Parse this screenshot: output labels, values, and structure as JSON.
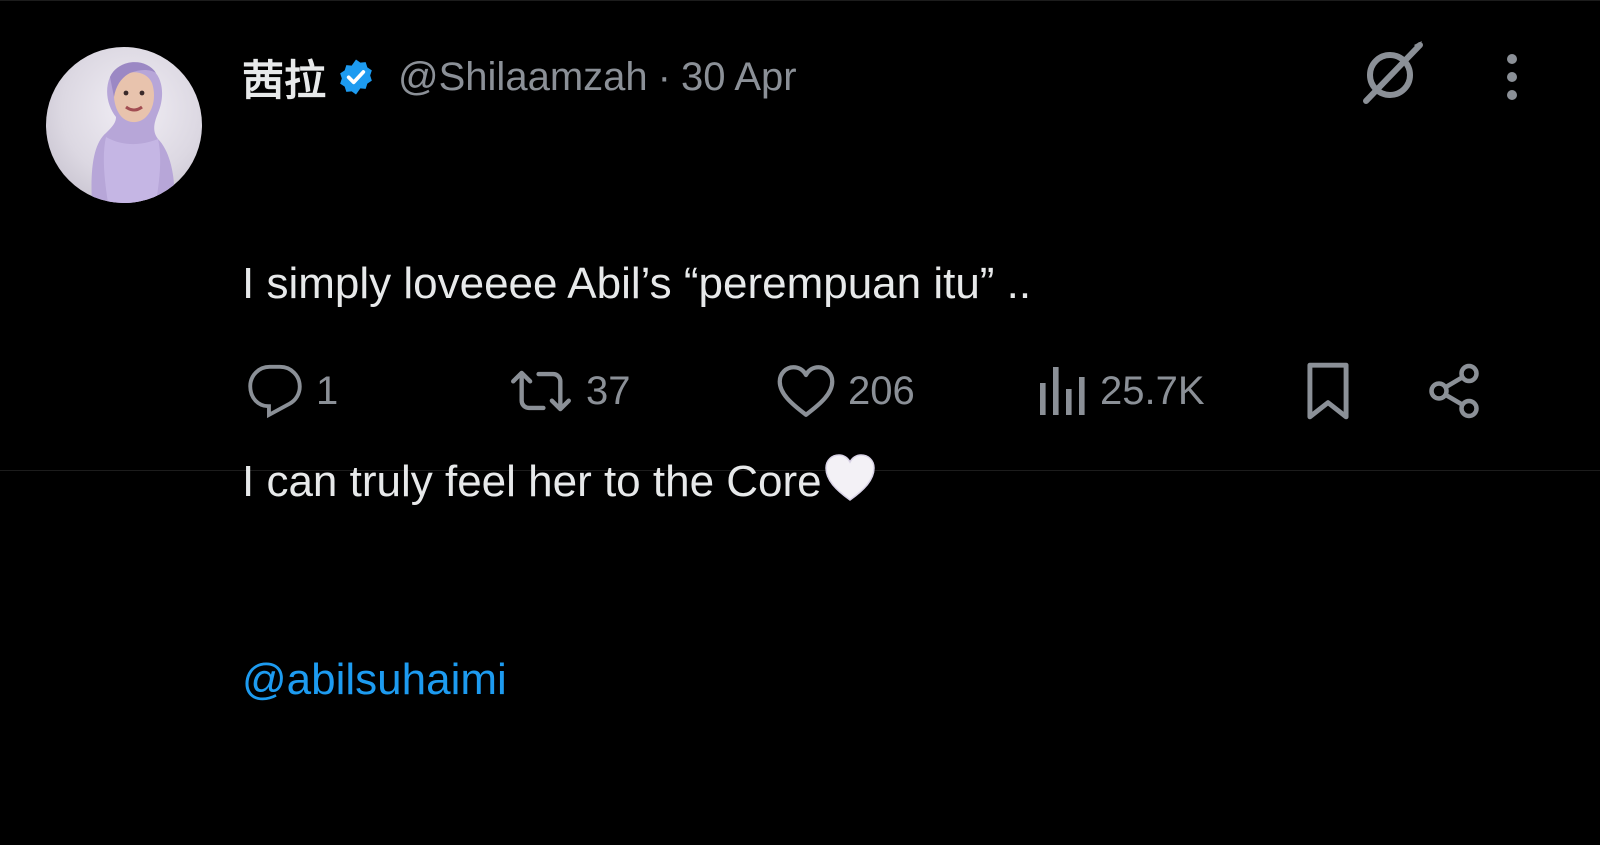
{
  "tweet": {
    "display_name": "茜拉",
    "handle": "@Shilaamzah",
    "separator": "·",
    "date": "30 Apr",
    "lines": [
      "I simply loveeee Abil’s “perempuan itu” ..",
      "I can truly feel her to the Core"
    ],
    "mention": "@abilsuhaimi",
    "emoji": "white-heart"
  },
  "actions": {
    "replies": "1",
    "reposts": "37",
    "likes": "206",
    "views": "25.7K"
  },
  "colors": {
    "background": "#000000",
    "text": "#e7e9ea",
    "muted": "#8b9097",
    "accent": "#1d9bf0"
  },
  "icons": [
    "verified-badge-icon",
    "grok-icon",
    "more-icon",
    "reply-icon",
    "repost-icon",
    "like-icon",
    "views-icon",
    "bookmark-icon",
    "share-icon"
  ]
}
